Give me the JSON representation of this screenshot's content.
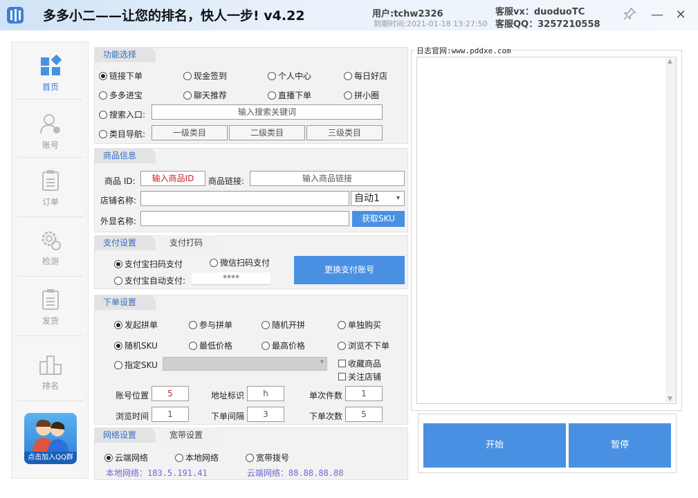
{
  "window": {
    "title": "多多小二——让您的排名，快人一步! v4.22",
    "user": "用户:tchw2326",
    "expire": "到期时间:2021-01-18 13:27:50",
    "service_vx": "客服vx：duoduoTC",
    "service_qq": "客服QQ：3257210558",
    "pin_icon": "pin-icon",
    "minimize": "—",
    "close": "✕"
  },
  "sidebar": {
    "items": [
      {
        "label": "首页",
        "icon": "home-grid-icon"
      },
      {
        "label": "账号",
        "icon": "user-account-icon"
      },
      {
        "label": "订单",
        "icon": "order-list-icon"
      },
      {
        "label": "检测",
        "icon": "gear-check-icon"
      },
      {
        "label": "发货",
        "icon": "shipping-list-icon"
      },
      {
        "label": "排名",
        "icon": "ranking-podium-icon"
      }
    ],
    "qq_group": "点击加入QQ群"
  },
  "func": {
    "tab": "功能选择",
    "options": [
      "链接下单",
      "现金签到",
      "个人中心",
      "每日好店",
      "多多进宝",
      "聊天推荐",
      "直播下单",
      "拼小圈"
    ],
    "search_label": "搜索入口:",
    "search_placeholder": "输入搜索关键词",
    "category_label": "类目导航:",
    "category_buttons": [
      "一级类目",
      "二级类目",
      "三级类目"
    ]
  },
  "goods": {
    "tab": "商品信息",
    "id_label": "商品 ID:",
    "id_placeholder": "输入商品ID",
    "link_label": "商品链接:",
    "link_placeholder": "输入商品链接",
    "shop_label": "店铺名称:",
    "shop_value": "",
    "auto_select": "自动1",
    "display_label": "外显名称:",
    "display_value": "",
    "sku_button": "获取SKU"
  },
  "pay": {
    "tab_active": "支付设置",
    "tab_inactive": "支付打码",
    "option_alipay_scan": "支付宝扫码支付",
    "option_wechat_scan": "微信扫码支付",
    "option_alipay_auto": "支付宝自动支付:",
    "password_mask": "****",
    "change_button": "更换支付账号"
  },
  "order": {
    "tab": "下单设置",
    "options_row1": [
      "发起拼单",
      "参与拼单",
      "随机开拼",
      "单独购买"
    ],
    "options_row2": [
      "随机SKU",
      "最低价格",
      "最高价格",
      "浏览不下单"
    ],
    "specify_sku": "指定SKU",
    "check_collect": "收藏商品",
    "check_follow": "关注店铺",
    "account_pos_label": "账号位置",
    "account_pos_value": "5",
    "address_label": "地址标识",
    "address_value": "h",
    "qty_label": "单次件数",
    "qty_value": "1",
    "browse_label": "浏览时间",
    "browse_value": "1",
    "interval_label": "下单间隔",
    "interval_value": "3",
    "times_label": "下单次数",
    "times_value": "5"
  },
  "network": {
    "tab_active": "网络设置",
    "tab_inactive": "宽带设置",
    "options": [
      "云端网络",
      "本地网络",
      "宽带拨号"
    ],
    "local_ip": "本地网络：183.5.191.41",
    "cloud_ip": "云端网络：88.88.88.88"
  },
  "log": {
    "title": "日志官网:www.pddxe.com",
    "start_button": "开始",
    "pause_button": "暂停"
  },
  "colors": {
    "accent": "#4a90e2",
    "tab_text": "#2f6fc9",
    "ip_text": "#6a6ad0",
    "id_placeholder": "#d02020"
  }
}
